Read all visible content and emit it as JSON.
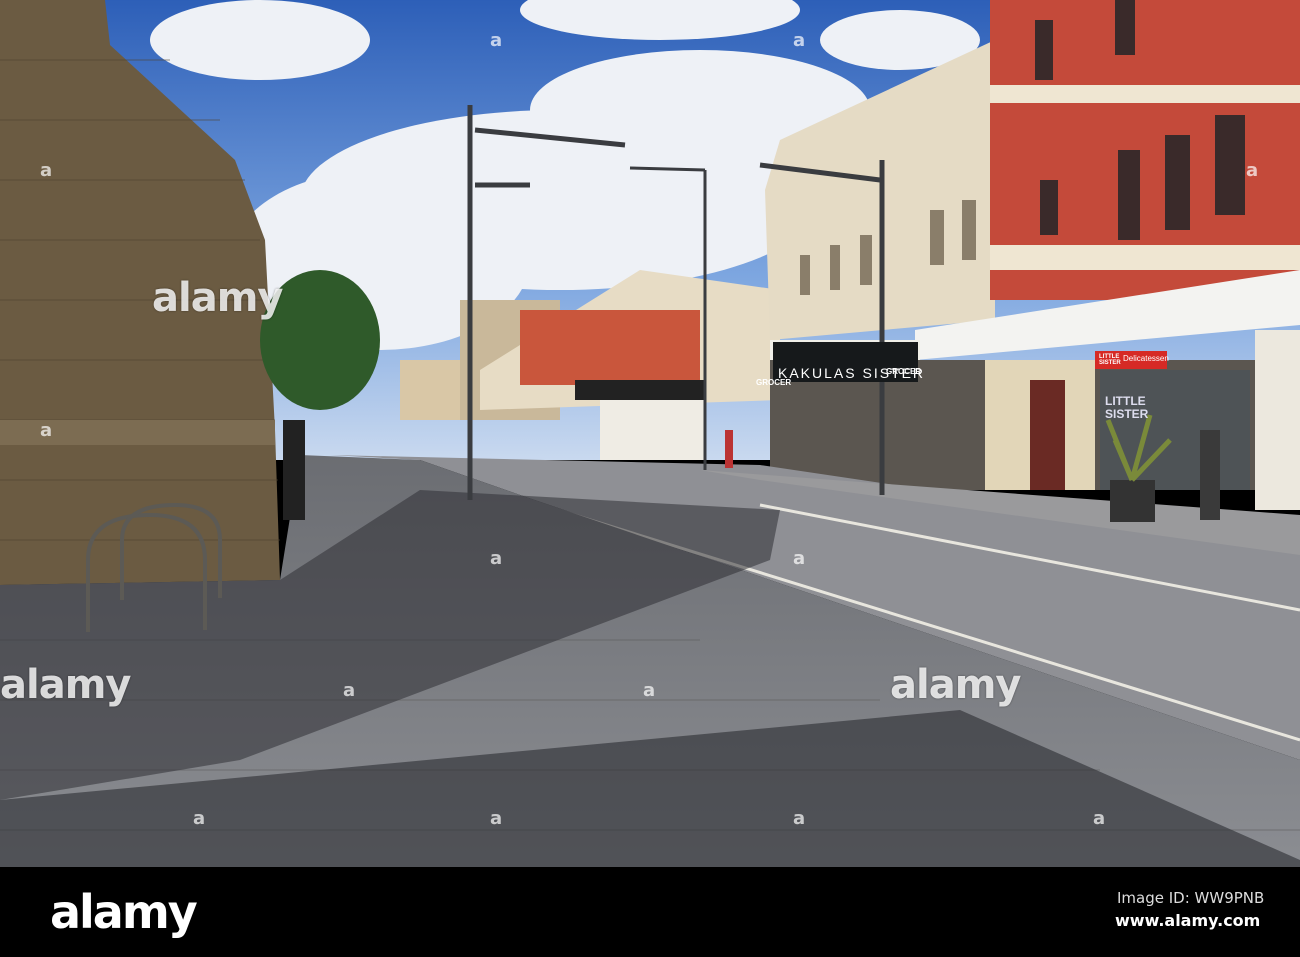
{
  "photo": {
    "signs": {
      "kakulas_sister": "KAKULAS SISTER",
      "grocer": "GROCER",
      "little_sister": "LITTLE SISTER",
      "delicatessen": "Delicatessen"
    }
  },
  "watermark": {
    "text": "alamy",
    "mark": "a"
  },
  "footer": {
    "logo": "alamy",
    "image_id": "Image ID: WW9PNB",
    "url": "www.alamy.com"
  }
}
